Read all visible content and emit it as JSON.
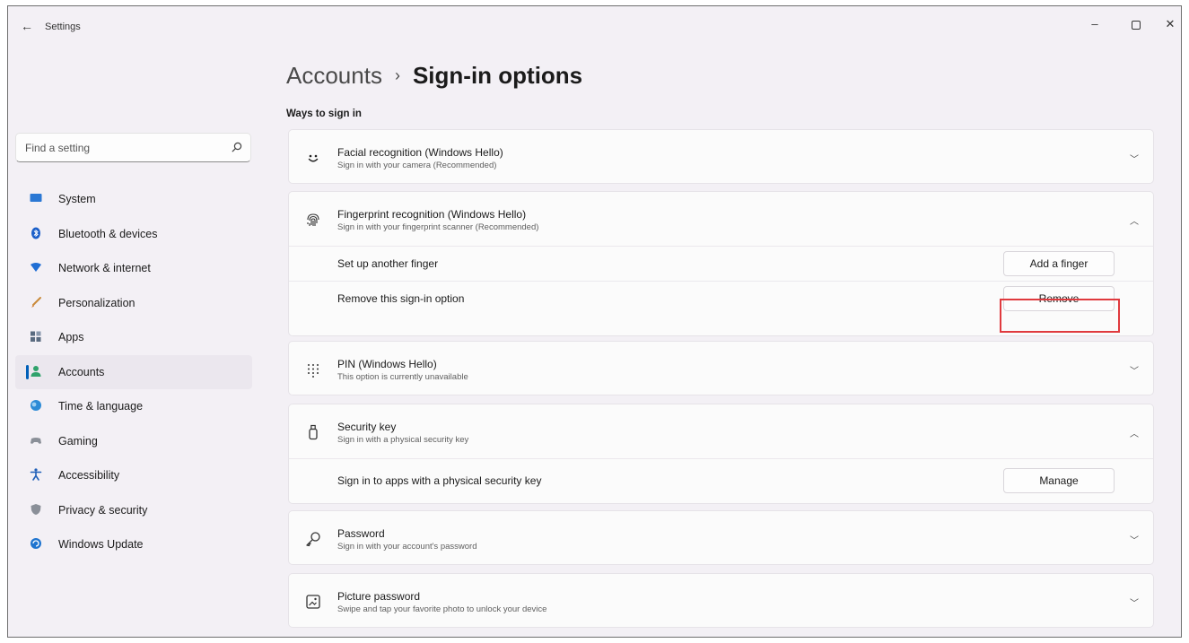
{
  "window": {
    "title": "Settings",
    "back_glyph": "←",
    "controls": {
      "minimize": "–",
      "close": "✕"
    }
  },
  "search": {
    "placeholder": "Find a setting",
    "icon": "search-icon"
  },
  "sidebar": {
    "items": [
      {
        "label": "System",
        "icon": "monitor-icon",
        "color": "#2b78d4"
      },
      {
        "label": "Bluetooth & devices",
        "icon": "bluetooth-icon",
        "color": "#1a5fc9"
      },
      {
        "label": "Network & internet",
        "icon": "wifi-icon",
        "color": "#1f6ed4"
      },
      {
        "label": "Personalization",
        "icon": "brush-icon",
        "color": "#d77a2e"
      },
      {
        "label": "Apps",
        "icon": "apps-icon",
        "color": "#5a6b80"
      },
      {
        "label": "Accounts",
        "icon": "person-icon",
        "color": "#2fa26b",
        "selected": true
      },
      {
        "label": "Time & language",
        "icon": "globe-clock-icon",
        "color": "#2d8bd6"
      },
      {
        "label": "Gaming",
        "icon": "gamepad-icon",
        "color": "#8a8f98"
      },
      {
        "label": "Accessibility",
        "icon": "accessibility-icon",
        "color": "#1f5fb8"
      },
      {
        "label": "Privacy & security",
        "icon": "shield-icon",
        "color": "#8a8f98"
      },
      {
        "label": "Windows Update",
        "icon": "update-icon",
        "color": "#1e74cf"
      }
    ]
  },
  "header": {
    "breadcrumb_parent": "Accounts",
    "breadcrumb_sep": "›",
    "breadcrumb_current": "Sign-in options"
  },
  "section": {
    "label": "Ways to sign in"
  },
  "options": {
    "facial": {
      "title": "Facial recognition (Windows Hello)",
      "subtitle": "Sign in with your camera (Recommended)",
      "icon": "face-icon",
      "expanded": false
    },
    "fingerprint": {
      "title": "Fingerprint recognition (Windows Hello)",
      "subtitle": "Sign in with your fingerprint scanner (Recommended)",
      "icon": "fingerprint-icon",
      "expanded": true,
      "rows": [
        {
          "label": "Set up another finger",
          "button": "Add a finger"
        },
        {
          "label": "Remove this sign-in option",
          "button": "Remove"
        }
      ]
    },
    "pin": {
      "title": "PIN (Windows Hello)",
      "subtitle": "This option is currently unavailable",
      "icon": "keypad-icon",
      "expanded": false
    },
    "security_key": {
      "title": "Security key",
      "subtitle": "Sign in with a physical security key",
      "icon": "usb-key-icon",
      "expanded": true,
      "rows": [
        {
          "label": "Sign in to apps with a physical security key",
          "button": "Manage"
        }
      ]
    },
    "password": {
      "title": "Password",
      "subtitle": "Sign in with your account's password",
      "icon": "key-icon",
      "expanded": false
    },
    "picture_password": {
      "title": "Picture password",
      "subtitle": "Swipe and tap your favorite photo to unlock your device",
      "icon": "picture-icon",
      "expanded": false
    }
  },
  "glyphs": {
    "chevron_down": "﹀",
    "chevron_up": "︿"
  },
  "highlight": {
    "target": "remove-button",
    "color": "#e03a3e"
  }
}
